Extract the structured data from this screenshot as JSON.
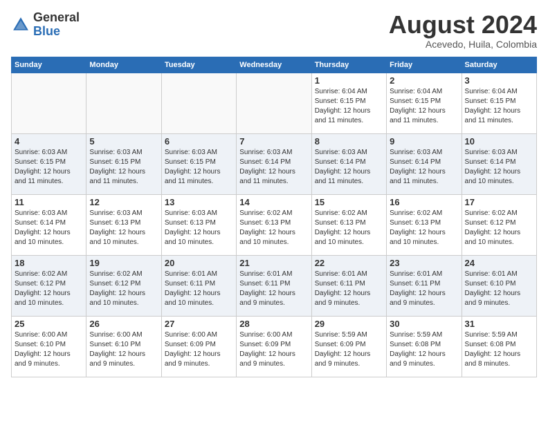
{
  "header": {
    "logo": {
      "general": "General",
      "blue": "Blue",
      "tagline": "GeneralBlue"
    },
    "title": "August 2024",
    "subtitle": "Acevedo, Huila, Colombia"
  },
  "weekdays": [
    "Sunday",
    "Monday",
    "Tuesday",
    "Wednesday",
    "Thursday",
    "Friday",
    "Saturday"
  ],
  "weeks": [
    [
      {
        "day": "",
        "info": ""
      },
      {
        "day": "",
        "info": ""
      },
      {
        "day": "",
        "info": ""
      },
      {
        "day": "",
        "info": ""
      },
      {
        "day": "1",
        "info": "Sunrise: 6:04 AM\nSunset: 6:15 PM\nDaylight: 12 hours\nand 11 minutes."
      },
      {
        "day": "2",
        "info": "Sunrise: 6:04 AM\nSunset: 6:15 PM\nDaylight: 12 hours\nand 11 minutes."
      },
      {
        "day": "3",
        "info": "Sunrise: 6:04 AM\nSunset: 6:15 PM\nDaylight: 12 hours\nand 11 minutes."
      }
    ],
    [
      {
        "day": "4",
        "info": "Sunrise: 6:03 AM\nSunset: 6:15 PM\nDaylight: 12 hours\nand 11 minutes."
      },
      {
        "day": "5",
        "info": "Sunrise: 6:03 AM\nSunset: 6:15 PM\nDaylight: 12 hours\nand 11 minutes."
      },
      {
        "day": "6",
        "info": "Sunrise: 6:03 AM\nSunset: 6:15 PM\nDaylight: 12 hours\nand 11 minutes."
      },
      {
        "day": "7",
        "info": "Sunrise: 6:03 AM\nSunset: 6:14 PM\nDaylight: 12 hours\nand 11 minutes."
      },
      {
        "day": "8",
        "info": "Sunrise: 6:03 AM\nSunset: 6:14 PM\nDaylight: 12 hours\nand 11 minutes."
      },
      {
        "day": "9",
        "info": "Sunrise: 6:03 AM\nSunset: 6:14 PM\nDaylight: 12 hours\nand 11 minutes."
      },
      {
        "day": "10",
        "info": "Sunrise: 6:03 AM\nSunset: 6:14 PM\nDaylight: 12 hours\nand 10 minutes."
      }
    ],
    [
      {
        "day": "11",
        "info": "Sunrise: 6:03 AM\nSunset: 6:14 PM\nDaylight: 12 hours\nand 10 minutes."
      },
      {
        "day": "12",
        "info": "Sunrise: 6:03 AM\nSunset: 6:13 PM\nDaylight: 12 hours\nand 10 minutes."
      },
      {
        "day": "13",
        "info": "Sunrise: 6:03 AM\nSunset: 6:13 PM\nDaylight: 12 hours\nand 10 minutes."
      },
      {
        "day": "14",
        "info": "Sunrise: 6:02 AM\nSunset: 6:13 PM\nDaylight: 12 hours\nand 10 minutes."
      },
      {
        "day": "15",
        "info": "Sunrise: 6:02 AM\nSunset: 6:13 PM\nDaylight: 12 hours\nand 10 minutes."
      },
      {
        "day": "16",
        "info": "Sunrise: 6:02 AM\nSunset: 6:13 PM\nDaylight: 12 hours\nand 10 minutes."
      },
      {
        "day": "17",
        "info": "Sunrise: 6:02 AM\nSunset: 6:12 PM\nDaylight: 12 hours\nand 10 minutes."
      }
    ],
    [
      {
        "day": "18",
        "info": "Sunrise: 6:02 AM\nSunset: 6:12 PM\nDaylight: 12 hours\nand 10 minutes."
      },
      {
        "day": "19",
        "info": "Sunrise: 6:02 AM\nSunset: 6:12 PM\nDaylight: 12 hours\nand 10 minutes."
      },
      {
        "day": "20",
        "info": "Sunrise: 6:01 AM\nSunset: 6:11 PM\nDaylight: 12 hours\nand 10 minutes."
      },
      {
        "day": "21",
        "info": "Sunrise: 6:01 AM\nSunset: 6:11 PM\nDaylight: 12 hours\nand 9 minutes."
      },
      {
        "day": "22",
        "info": "Sunrise: 6:01 AM\nSunset: 6:11 PM\nDaylight: 12 hours\nand 9 minutes."
      },
      {
        "day": "23",
        "info": "Sunrise: 6:01 AM\nSunset: 6:11 PM\nDaylight: 12 hours\nand 9 minutes."
      },
      {
        "day": "24",
        "info": "Sunrise: 6:01 AM\nSunset: 6:10 PM\nDaylight: 12 hours\nand 9 minutes."
      }
    ],
    [
      {
        "day": "25",
        "info": "Sunrise: 6:00 AM\nSunset: 6:10 PM\nDaylight: 12 hours\nand 9 minutes."
      },
      {
        "day": "26",
        "info": "Sunrise: 6:00 AM\nSunset: 6:10 PM\nDaylight: 12 hours\nand 9 minutes."
      },
      {
        "day": "27",
        "info": "Sunrise: 6:00 AM\nSunset: 6:09 PM\nDaylight: 12 hours\nand 9 minutes."
      },
      {
        "day": "28",
        "info": "Sunrise: 6:00 AM\nSunset: 6:09 PM\nDaylight: 12 hours\nand 9 minutes."
      },
      {
        "day": "29",
        "info": "Sunrise: 5:59 AM\nSunset: 6:09 PM\nDaylight: 12 hours\nand 9 minutes."
      },
      {
        "day": "30",
        "info": "Sunrise: 5:59 AM\nSunset: 6:08 PM\nDaylight: 12 hours\nand 9 minutes."
      },
      {
        "day": "31",
        "info": "Sunrise: 5:59 AM\nSunset: 6:08 PM\nDaylight: 12 hours\nand 8 minutes."
      }
    ]
  ]
}
